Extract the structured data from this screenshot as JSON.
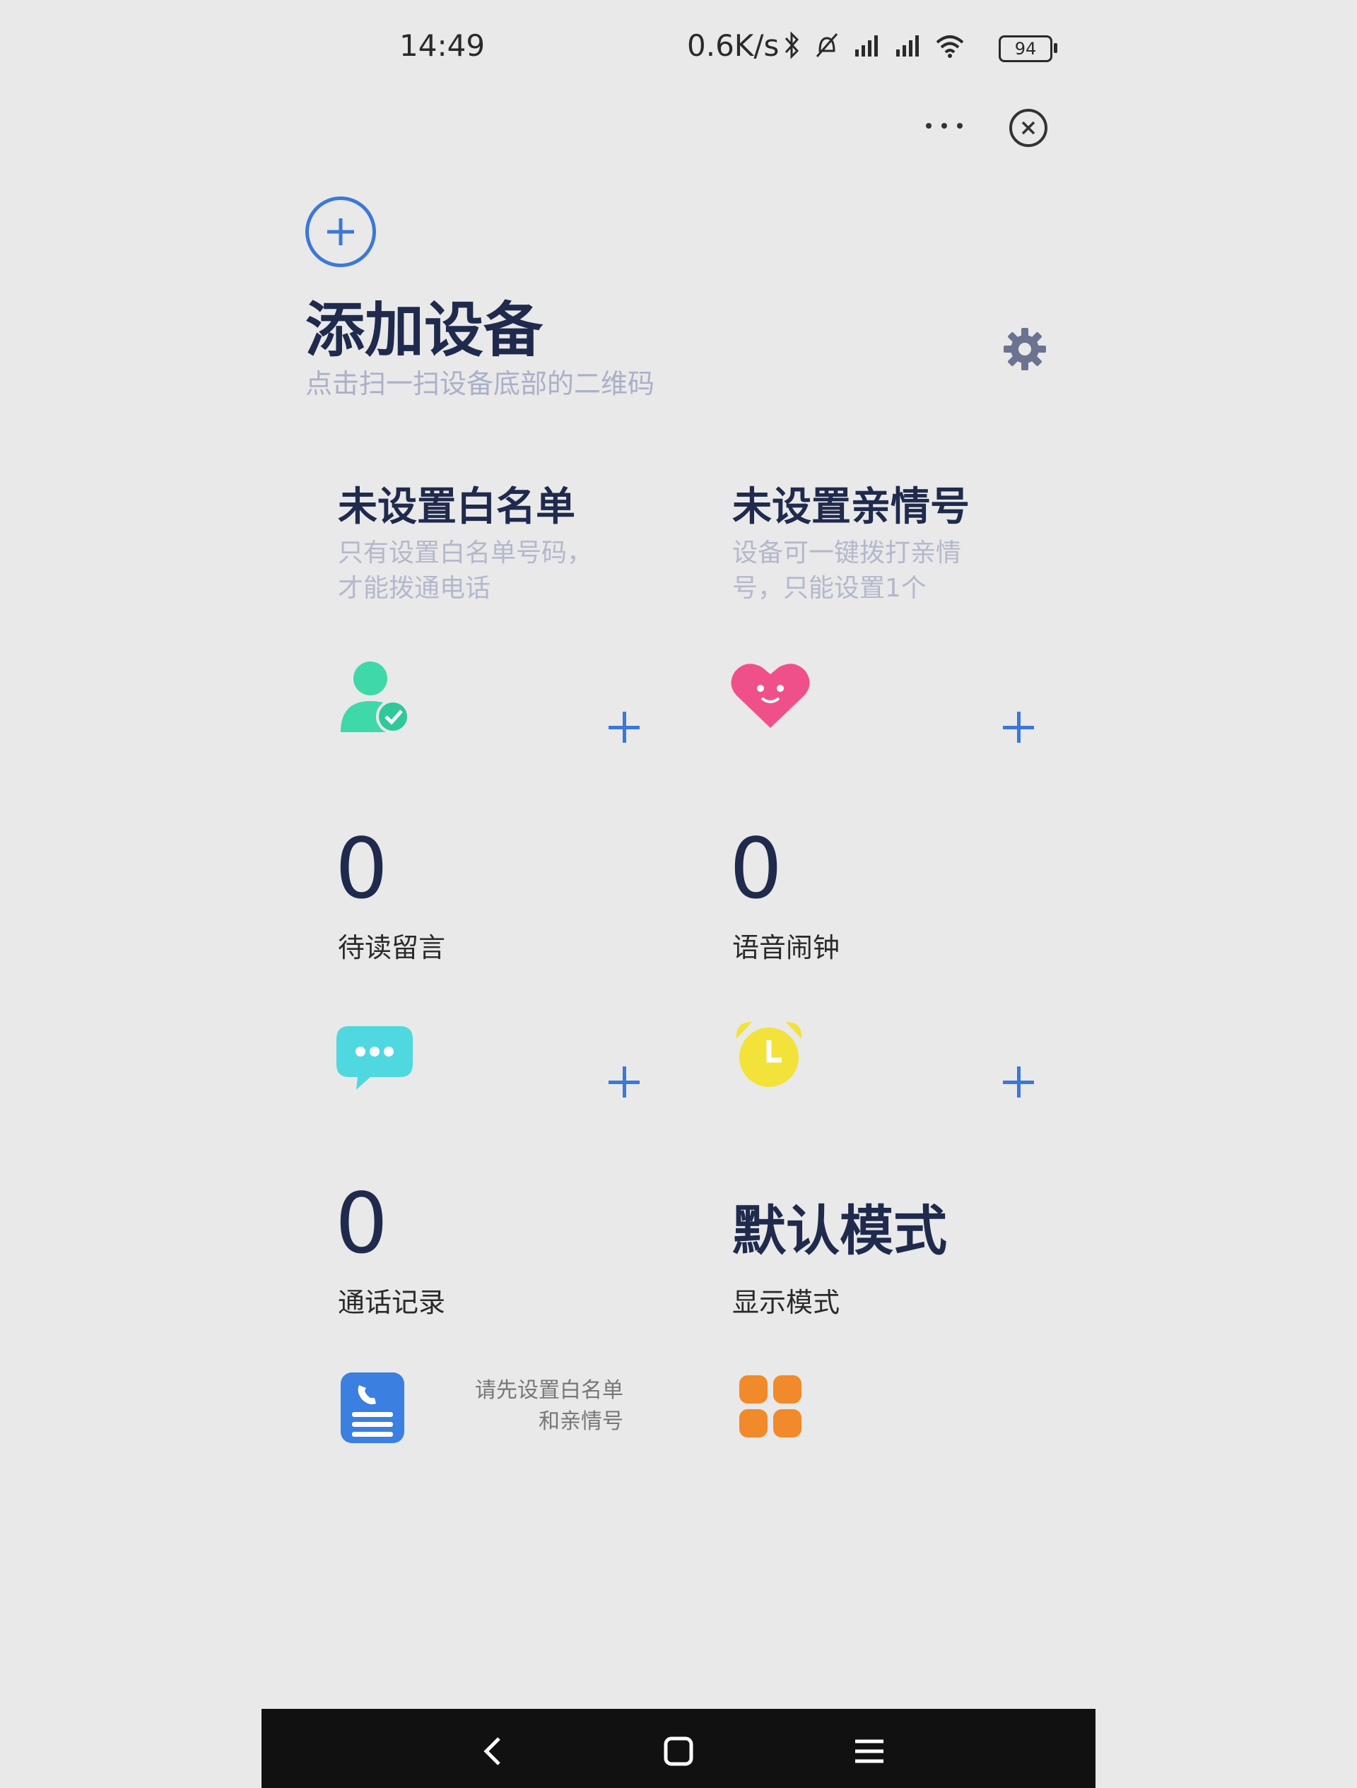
{
  "status_bar": {
    "time": "14:49",
    "net_speed": "0.6K/s",
    "battery": "94"
  },
  "header": {
    "add_title": "添加设备",
    "add_subtitle": "点击扫一扫设备底部的二维码"
  },
  "cards": {
    "whitelist": {
      "title": "未设置白名单",
      "desc_line1": "只有设置白名单号码，",
      "desc_line2": "才能拨通电话"
    },
    "family": {
      "title": "未设置亲情号",
      "desc_line1": "设备可一键拨打亲情",
      "desc_line2": "号，只能设置1个"
    },
    "messages": {
      "value": "0",
      "label": "待读留言"
    },
    "alarm": {
      "value": "0",
      "label": "语音闹钟"
    },
    "calls": {
      "value": "0",
      "label": "通话记录",
      "hint_line1": "请先设置白名单",
      "hint_line2": "和亲情号"
    },
    "display": {
      "value": "默认模式",
      "label": "显示模式"
    }
  },
  "colors": {
    "accent": "#3b78d8",
    "title": "#1f2a4d",
    "subtle": "#b3b8cc",
    "whitelist_icon": "#3fd8a8",
    "heart_icon": "#f0508a",
    "message_icon": "#4fd8e0",
    "alarm_icon": "#f2e23a",
    "calls_icon": "#3b7fe0",
    "display_icon": "#f08a2a"
  }
}
